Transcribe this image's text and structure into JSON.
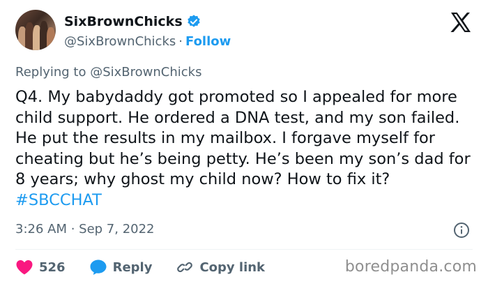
{
  "author": {
    "name": "SixBrownChicks",
    "handle": "@SixBrownChicks",
    "separator": "·",
    "follow_label": "Follow"
  },
  "replying_to": "Replying to @SixBrownChicks",
  "tweet": {
    "text": "Q4. My babydaddy got promoted so I appealed for more child support. He ordered a DNA test, and my son failed. He put the results in my mailbox. I forgave myself for cheating but he’s being petty. He’s been my son’s dad for 8 years; why ghost my child now? How to fix it? ",
    "hashtag": "#SBCCHAT",
    "timestamp": "3:26 AM · Sep 7, 2022"
  },
  "actions": {
    "like_count": "526",
    "reply_label": "Reply",
    "copy_link_label": "Copy link"
  },
  "watermark": "boredpanda.com",
  "colors": {
    "accent": "#1d9bf0",
    "like": "#f91880",
    "muted": "#536471",
    "text": "#0f1419"
  },
  "icons": {
    "verified": "verified-badge-icon",
    "x_logo": "x-logo-icon",
    "info": "info-icon",
    "like": "heart-icon",
    "reply": "speech-bubble-icon",
    "copy_link": "link-icon"
  }
}
